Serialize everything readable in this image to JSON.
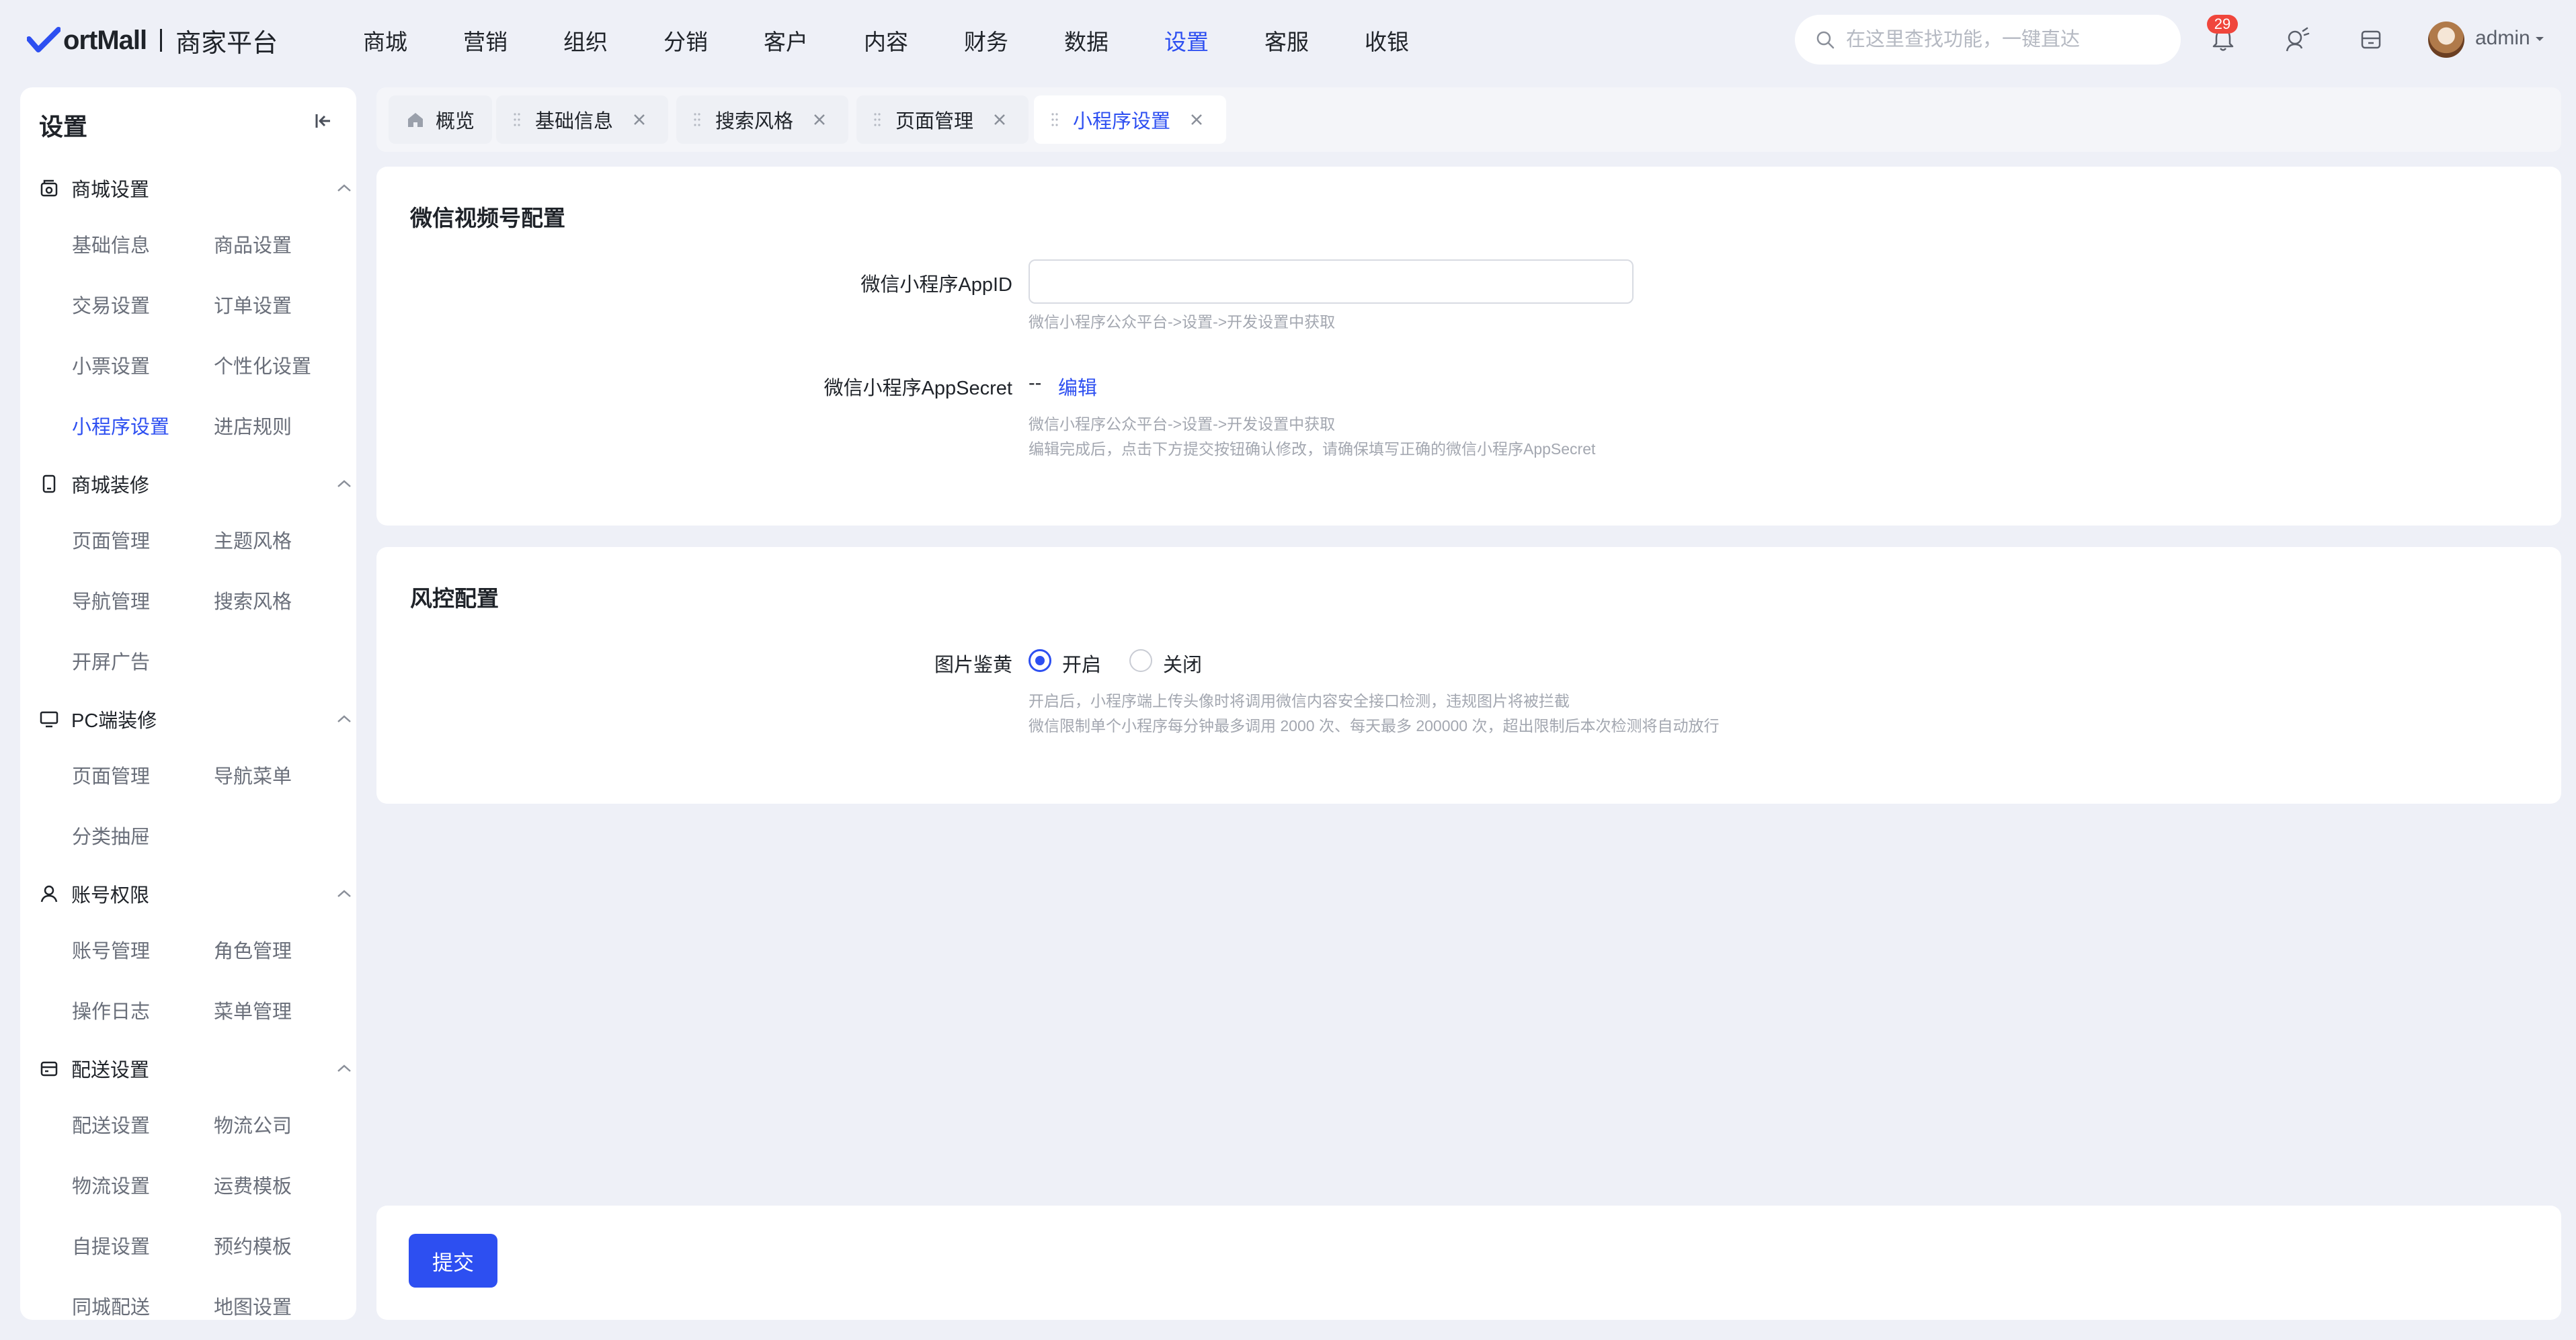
{
  "brand": {
    "name": "ortMall",
    "subtitle": "商家平台",
    "accent": "#2d4ff1"
  },
  "topnav": [
    "商城",
    "营销",
    "组织",
    "分销",
    "客户",
    "内容",
    "财务",
    "数据",
    "设置",
    "客服",
    "收银"
  ],
  "topnav_active": "设置",
  "search": {
    "placeholder": "在这里查找功能，一键直达"
  },
  "header": {
    "notification_count": "29",
    "user": "admin"
  },
  "sidebar": {
    "title": "设置",
    "groups": [
      {
        "label": "商城设置",
        "icon": "store-icon",
        "items": [
          "基础信息",
          "商品设置",
          "交易设置",
          "订单设置",
          "小票设置",
          "个性化设置",
          "小程序设置",
          "进店规则"
        ]
      },
      {
        "label": "商城装修",
        "icon": "phone-icon",
        "items": [
          "页面管理",
          "主题风格",
          "导航管理",
          "搜索风格",
          "开屏广告"
        ]
      },
      {
        "label": "PC端装修",
        "icon": "monitor-icon",
        "items": [
          "页面管理",
          "导航菜单",
          "分类抽屉"
        ]
      },
      {
        "label": "账号权限",
        "icon": "user-icon",
        "items": [
          "账号管理",
          "角色管理",
          "操作日志",
          "菜单管理"
        ]
      },
      {
        "label": "配送设置",
        "icon": "delivery-icon",
        "items": [
          "配送设置",
          "物流公司",
          "物流设置",
          "运费模板",
          "自提设置",
          "预约模板",
          "同城配送",
          "地图设置"
        ]
      }
    ],
    "active_item": "小程序设置"
  },
  "tabs": [
    {
      "label": "概览",
      "closable": false
    },
    {
      "label": "基础信息",
      "closable": true
    },
    {
      "label": "搜索风格",
      "closable": true
    },
    {
      "label": "页面管理",
      "closable": true
    },
    {
      "label": "小程序设置",
      "closable": true,
      "active": true
    }
  ],
  "wechat_card": {
    "title": "微信视频号配置",
    "appid": {
      "label": "微信小程序AppID",
      "value": "",
      "help": "微信小程序公众平台->设置->开发设置中获取"
    },
    "appsecret": {
      "label": "微信小程序AppSecret",
      "value": "--",
      "edit": "编辑",
      "help1": "微信小程序公众平台->设置->开发设置中获取",
      "help2": "编辑完成后，点击下方提交按钮确认修改，请确保填写正确的微信小程序AppSecret"
    }
  },
  "risk_card": {
    "title": "风控配置",
    "image_check": {
      "label": "图片鉴黄",
      "options": [
        "开启",
        "关闭"
      ],
      "selected": "开启",
      "help1": "开启后，小程序端上传头像时将调用微信内容安全接口检测，违规图片将被拦截",
      "help2": "微信限制单个小程序每分钟最多调用 2000 次、每天最多 200000 次，超出限制后本次检测将自动放行"
    }
  },
  "footer": {
    "submit": "提交"
  }
}
